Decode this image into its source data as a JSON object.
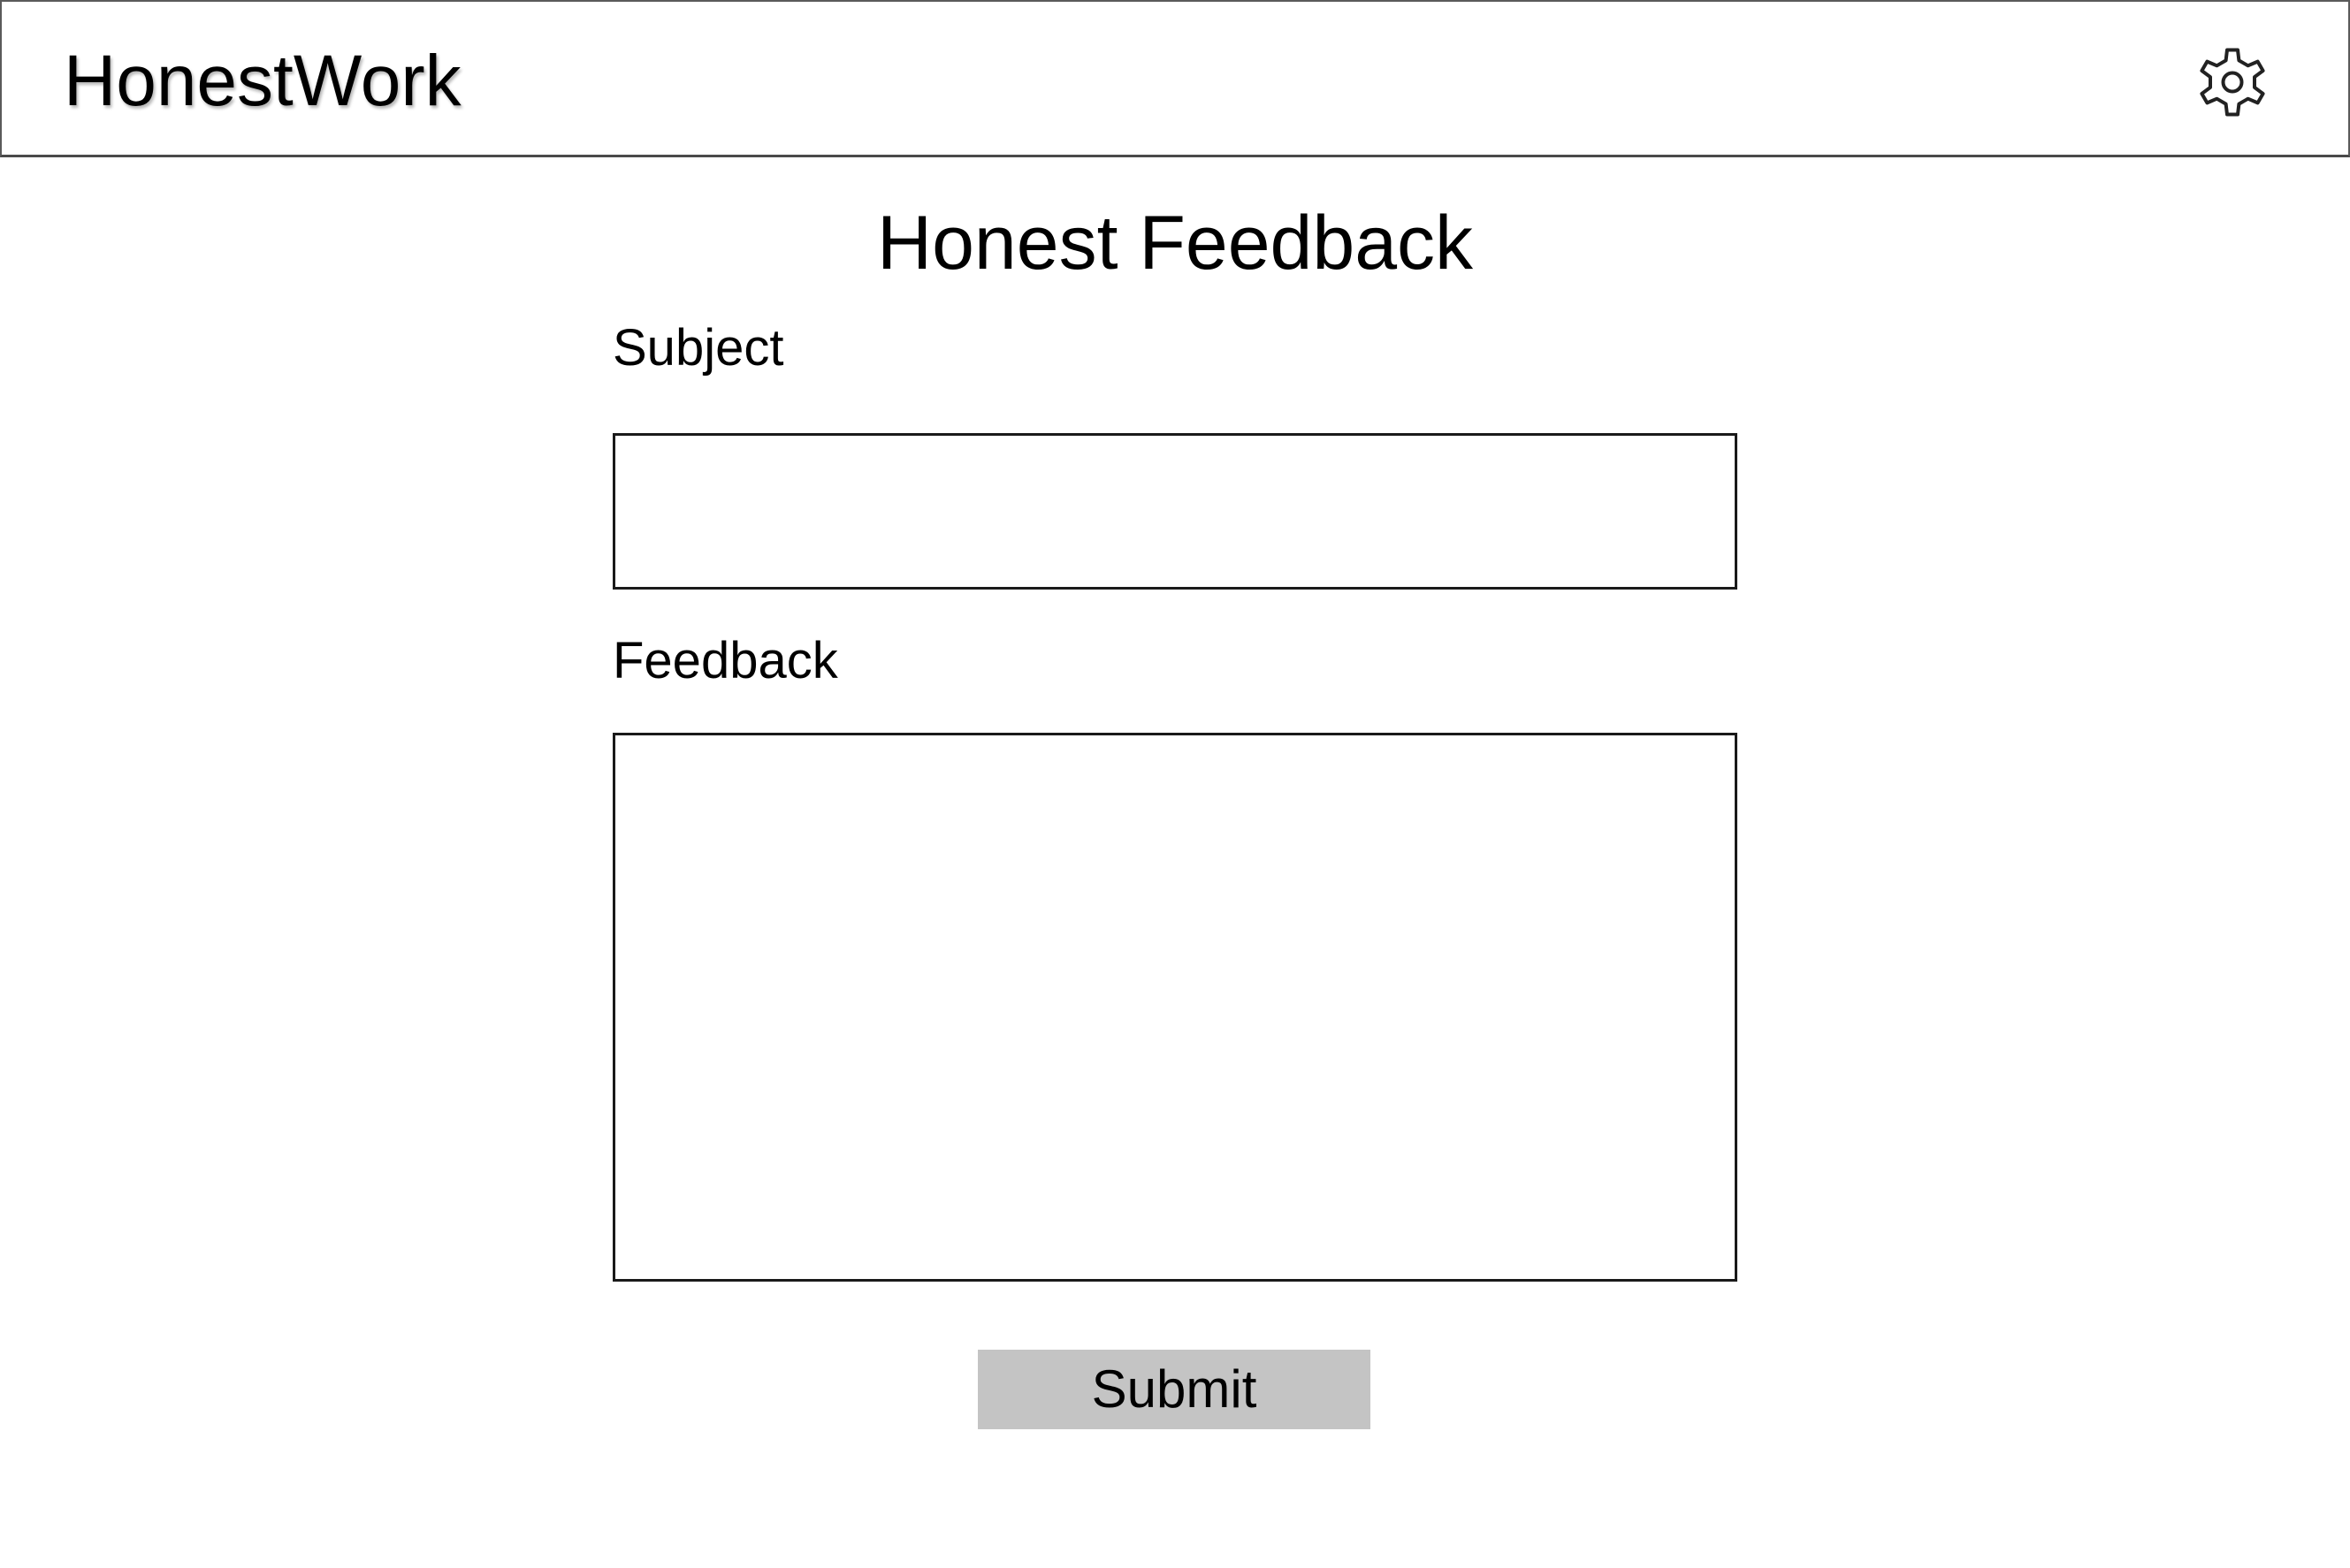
{
  "header": {
    "app_name": "HonestWork",
    "settings_icon": "gear-icon"
  },
  "main": {
    "title": "Honest Feedback",
    "subject": {
      "label": "Subject",
      "value": "",
      "placeholder": ""
    },
    "feedback": {
      "label": "Feedback",
      "value": "",
      "placeholder": ""
    },
    "submit_label": "Submit"
  },
  "colors": {
    "header_border": "#4a4a4a",
    "button_background": "#c4c4c4",
    "field_border": "#1a1a1a"
  }
}
